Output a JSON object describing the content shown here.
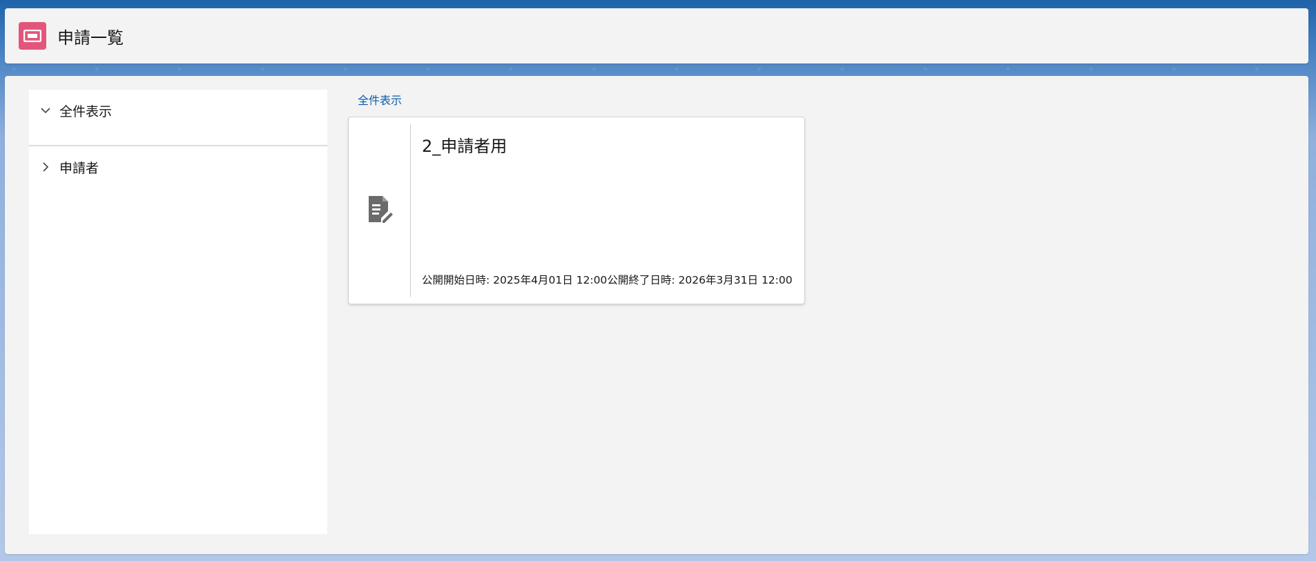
{
  "header": {
    "title": "申請一覧",
    "icon": "ticket-icon",
    "icon_color": "#e3567c"
  },
  "sidebar": {
    "items": [
      {
        "label": "全件表示",
        "icon": "chevron-down-icon",
        "expanded": true
      },
      {
        "label": "申請者",
        "icon": "chevron-right-icon",
        "expanded": false
      }
    ]
  },
  "main": {
    "breadcrumb": "全件表示",
    "cards": [
      {
        "title": "2_申請者用",
        "icon": "document-edit-icon",
        "start_label": "公開開始日時:",
        "start_value": "2025年4月01日 12:00",
        "end_label": "公開終了日時:",
        "end_value": "2026年3月31日 12:00"
      }
    ]
  },
  "colors": {
    "link": "#0b5cab",
    "panel_bg": "#f3f3f3",
    "background_top": "#1f63a8"
  }
}
